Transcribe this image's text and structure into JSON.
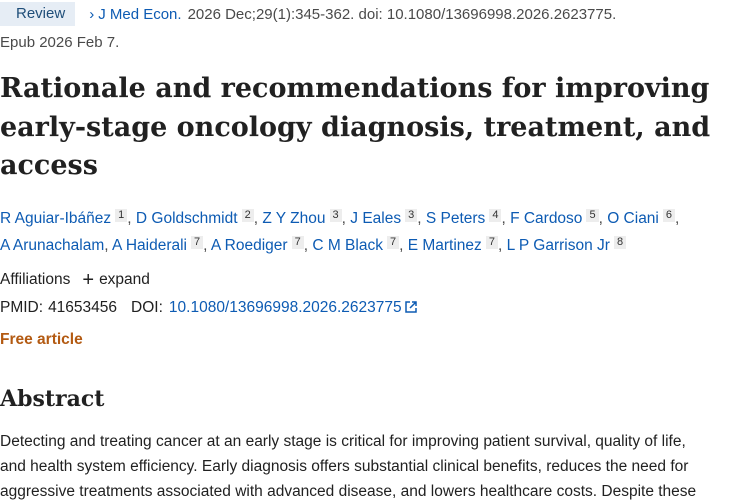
{
  "header": {
    "badge": "Review",
    "chevron_glyph": "›",
    "journal": "J Med Econ.",
    "citation": "2026 Dec;29(1):345-362. doi: 10.1080/13696998.2026.2623775.",
    "epub": "Epub 2026 Feb 7."
  },
  "title": "Rationale and recommendations for improving early-stage oncology diagnosis, treatment, and access",
  "authors": [
    {
      "name": "R Aguiar-Ibáñez",
      "aff": "1"
    },
    {
      "name": "D Goldschmidt",
      "aff": "2"
    },
    {
      "name": "Z Y Zhou",
      "aff": "3"
    },
    {
      "name": "J Eales",
      "aff": "3"
    },
    {
      "name": "S Peters",
      "aff": "4"
    },
    {
      "name": "F Cardoso",
      "aff": "5"
    },
    {
      "name": "O Ciani",
      "aff": "6"
    },
    {
      "name": "A Arunachalam",
      "aff": ""
    },
    {
      "name": "A Haiderali",
      "aff": "7"
    },
    {
      "name": "A Roediger",
      "aff": "7"
    },
    {
      "name": "C M Black",
      "aff": "7"
    },
    {
      "name": "E Martinez",
      "aff": "7"
    },
    {
      "name": "L P Garrison Jr",
      "aff": "8"
    }
  ],
  "affiliations": {
    "label": "Affiliations",
    "expand_icon": "plus-icon",
    "expand": "expand"
  },
  "ids": {
    "pmid_label": "PMID:",
    "pmid": "41653456",
    "doi_label": "DOI:",
    "doi": "10.1080/13696998.2026.2623775",
    "doi_icon": "external-link-icon"
  },
  "free_article": "Free article",
  "abstract": {
    "heading": "Abstract",
    "lines": [
      "Detecting and treating cancer at an early stage is critical for improving patient survival, quality of life,",
      "and health system efficiency. Early diagnosis offers substantial clinical benefits, reduces the need for",
      "aggressive treatments associated with advanced disease, and lowers healthcare costs. Despite these"
    ]
  },
  "colors": {
    "link": "#0d5bb3",
    "free": "#b35a12",
    "badge_bg": "#e6edf5"
  }
}
